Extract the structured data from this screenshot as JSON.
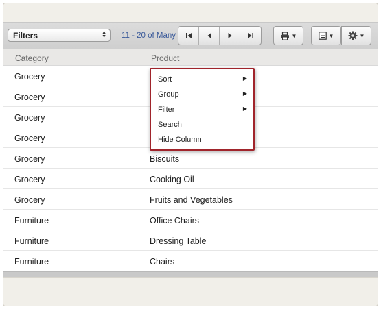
{
  "toolbar": {
    "filters_label": "Filters",
    "pager_text": "11 - 20 of Many",
    "pager_buttons": [
      {
        "name": "first-page-button",
        "icon": "skip-first-icon",
        "glyph": "⏮"
      },
      {
        "name": "prev-page-button",
        "icon": "triangle-left-icon",
        "glyph": "◀"
      },
      {
        "name": "next-page-button",
        "icon": "triangle-right-icon",
        "glyph": "▶"
      },
      {
        "name": "last-page-button",
        "icon": "skip-last-icon",
        "glyph": "⏭"
      }
    ],
    "print_icon": "printer-icon",
    "columns_icon": "list-icon",
    "settings_icon": "gear-icon"
  },
  "table": {
    "columns": [
      "Category",
      "Product"
    ],
    "rows": [
      [
        "Grocery",
        ""
      ],
      [
        "Grocery",
        ""
      ],
      [
        "Grocery",
        ""
      ],
      [
        "Grocery",
        ""
      ],
      [
        "Grocery",
        "Biscuits"
      ],
      [
        "Grocery",
        "Cooking Oil"
      ],
      [
        "Grocery",
        "Fruits and Vegetables"
      ],
      [
        "Furniture",
        "Office Chairs"
      ],
      [
        "Furniture",
        "Dressing Table"
      ],
      [
        "Furniture",
        "Chairs"
      ]
    ]
  },
  "context_menu": {
    "items": [
      {
        "label": "Sort",
        "submenu": true
      },
      {
        "label": "Group",
        "submenu": true
      },
      {
        "label": "Filter",
        "submenu": true
      },
      {
        "label": "Search",
        "submenu": false
      },
      {
        "label": "Hide Column",
        "submenu": false
      }
    ],
    "border_color": "#a0242b"
  },
  "colors": {
    "pager_text": "#3a5a9a",
    "header_background": "#e9e8e6",
    "menu_accent": "#a0242b"
  }
}
